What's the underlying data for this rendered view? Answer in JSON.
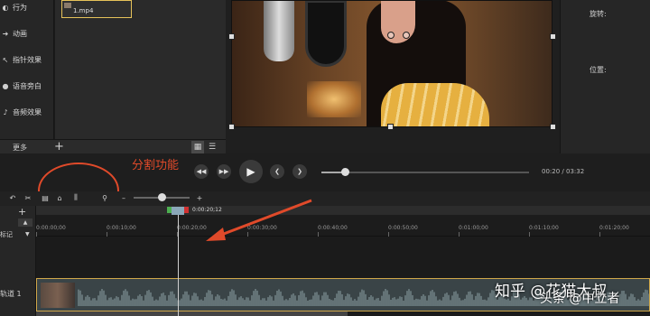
{
  "left_panel": {
    "tools": [
      {
        "label": "行为",
        "icon": "behavior-icon"
      },
      {
        "label": "动画",
        "icon": "animation-icon"
      },
      {
        "label": "指针效果",
        "icon": "cursor-effects-icon"
      },
      {
        "label": "语音旁白",
        "icon": "microphone-icon"
      },
      {
        "label": "音频效果",
        "icon": "audio-effects-icon"
      }
    ],
    "more_label": "更多",
    "add_label": "+"
  },
  "media_bin": {
    "file_name": "1.mp4"
  },
  "properties": {
    "rotation_label": "旋转:",
    "position_label": "位置:"
  },
  "playback": {
    "current_time": "00:20",
    "separator": "/",
    "total_time": "03:32",
    "progress": 0.113
  },
  "annotation": {
    "text": "分割功能",
    "color": "#e04a2a"
  },
  "timeline": {
    "playhead_time": "0:00:20;12",
    "ticks": [
      "0:00:00;00",
      "0:00:10;00",
      "0:00:20;00",
      "0:00:30;00",
      "0:00:40;00",
      "0:00:50;00",
      "0:01:00;00",
      "0:01:10;00",
      "0:01:20;00"
    ],
    "marker_label": "标记",
    "track_label": "轨道 1",
    "zoom_minus": "–",
    "zoom_plus": "+",
    "add_track": "+"
  },
  "watermark": {
    "text": "知乎 @花猫大叔",
    "overlay": "头条 @中立者"
  }
}
